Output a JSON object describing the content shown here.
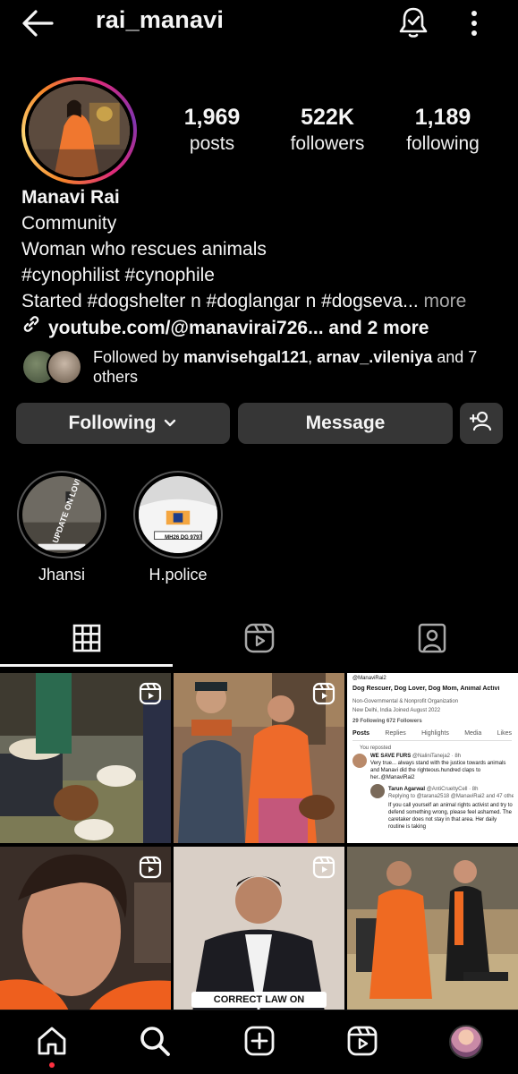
{
  "header": {
    "username": "rai_manavi"
  },
  "stats": [
    {
      "value": "1,969",
      "label": "posts"
    },
    {
      "value": "522K",
      "label": "followers"
    },
    {
      "value": "1,189",
      "label": "following"
    }
  ],
  "bio": {
    "name": "Manavi Rai",
    "category": "Community",
    "line1": "Woman who rescues animals",
    "line2": "#cynophilist #cynophile",
    "line3": "Started #dogshelter n #doglangar n #dogseva...",
    "more": "more",
    "link": "youtube.com/@manavirai726... and 2 more"
  },
  "followed_by": {
    "prefix": "Followed by ",
    "user1": "manvisehgal121",
    "sep": ", ",
    "user2": "arnav_.vileniya",
    "suffix": " and 7 others"
  },
  "buttons": {
    "following": "Following",
    "message": "Message"
  },
  "highlights": [
    {
      "label": "Jhansi"
    },
    {
      "label": "H.police"
    }
  ],
  "highlight_texts": {
    "jhansi_overlay": "UPDATE ON LOVE",
    "police_plate": "MH26 DG 9797"
  },
  "tweet_post": {
    "handle": "@ManaviRai2",
    "bio": "Dog Rescuer, Dog Lover, Dog Mom, Animal Activi",
    "org": "Non-Governmental & Nonprofit Organization",
    "loc": "New Delhi, India",
    "joined": "Joined August 2022",
    "following": "29 Following",
    "followers": "672 Followers",
    "tabs": [
      "Posts",
      "Replies",
      "Highlights",
      "Media",
      "Likes"
    ],
    "reposted": "You reposted",
    "title": "WE SAVE FURS",
    "title_handle": "@NaliniTaneja2 · 8h",
    "body1": "Very true... always stand with the justice towards animals and Manavi did the righteous.hundred claps to her..@ManaviRai2",
    "reply_name": "Tarun Agarwal",
    "reply_handle": "@AntiCrueltyCell · 8h",
    "replying": "Replying to @tarana2518 @ManaviRai2 and 47 others",
    "body2": "If you call yourself an animal rights activist and try to defend something wrong, please feel ashamed. The caretaker does not stay in that area. Her daily routine is taking"
  },
  "grid_captions": {
    "cell5": "CORRECT LAW ON FEEDING"
  },
  "colors": {
    "background": "#000000",
    "button": "#363636",
    "muted": "#a8a8a8",
    "notif": "#ff3040"
  }
}
